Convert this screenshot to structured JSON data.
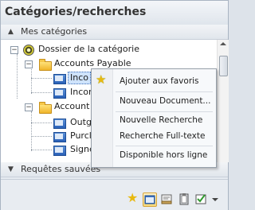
{
  "window": {
    "title": "Catégories/recherches"
  },
  "sections": {
    "my_categories": "Mes catégories",
    "saved_queries": "Requêtes sauvées"
  },
  "tree": {
    "root": "Dossier de la catégorie",
    "folders": [
      {
        "label": "Accounts Payable",
        "items": [
          "Inco",
          "Incor"
        ]
      },
      {
        "label": "Account",
        "items": [
          "Outg",
          "Purcl",
          "Signe"
        ]
      }
    ]
  },
  "context_menu": {
    "items": [
      "Ajouter aux favoris",
      "Nouveau Document...",
      "Nouvelle Recherche",
      "Recherche Full-texte",
      "Disponible hors ligne"
    ]
  },
  "toolbar": {
    "icons": [
      "star-icon",
      "folder-view-icon",
      "form-icon",
      "clipboard-icon",
      "checklist-icon"
    ]
  },
  "colors": {
    "panel_bg": "#e6ebf1",
    "menu_bg": "#f7f9fb",
    "selection": "#cfe3fb",
    "accent": "#e8b910"
  }
}
